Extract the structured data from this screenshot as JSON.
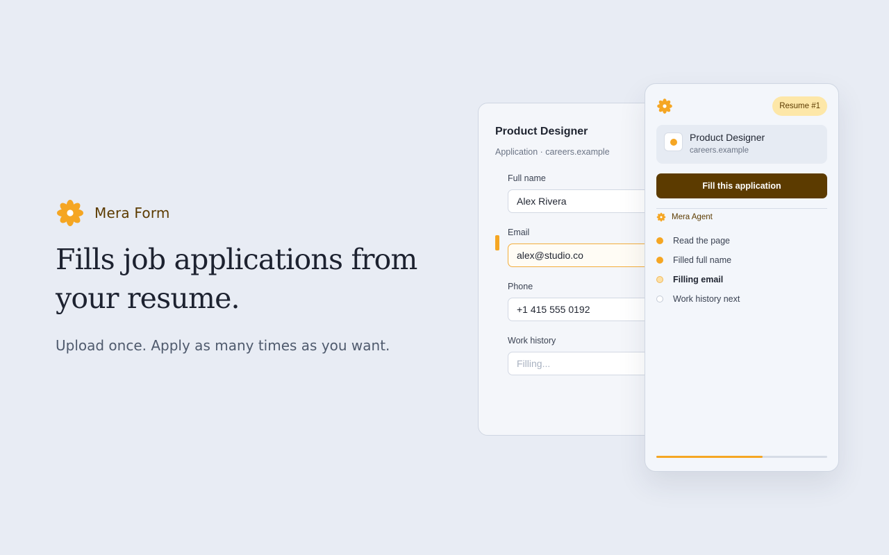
{
  "brand": {
    "name": "Mera Form",
    "icon": "flower-icon",
    "accent_color": "#f5a623",
    "brand_color": "#5c3b00"
  },
  "hero": {
    "headline": "Fills job applications from your resume.",
    "subline": "Upload once. Apply as many times as you want."
  },
  "form": {
    "title": "Product Designer",
    "subtitle": "Application · careers.example",
    "fields": [
      {
        "label": "Full name",
        "value": "Alex Rivera",
        "state": "filled"
      },
      {
        "label": "Email",
        "value": "alex@studio.co",
        "state": "active"
      },
      {
        "label": "Phone",
        "value": "+1 415 555 0192",
        "state": "filled"
      },
      {
        "label": "Work history",
        "placeholder": "Filling...",
        "state": "pending"
      }
    ]
  },
  "panel": {
    "badge": "Resume #1",
    "job": {
      "title": "Product Designer",
      "site": "careers.example"
    },
    "fill_button": "Fill this application",
    "agent": {
      "name": "Mera Agent",
      "icon": "flower-icon"
    },
    "steps": [
      {
        "label": "Read the page",
        "status": "done"
      },
      {
        "label": "Filled full name",
        "status": "done"
      },
      {
        "label": "Filling email",
        "status": "current"
      },
      {
        "label": "Work history next",
        "status": "todo"
      }
    ],
    "progress": 0.62
  }
}
